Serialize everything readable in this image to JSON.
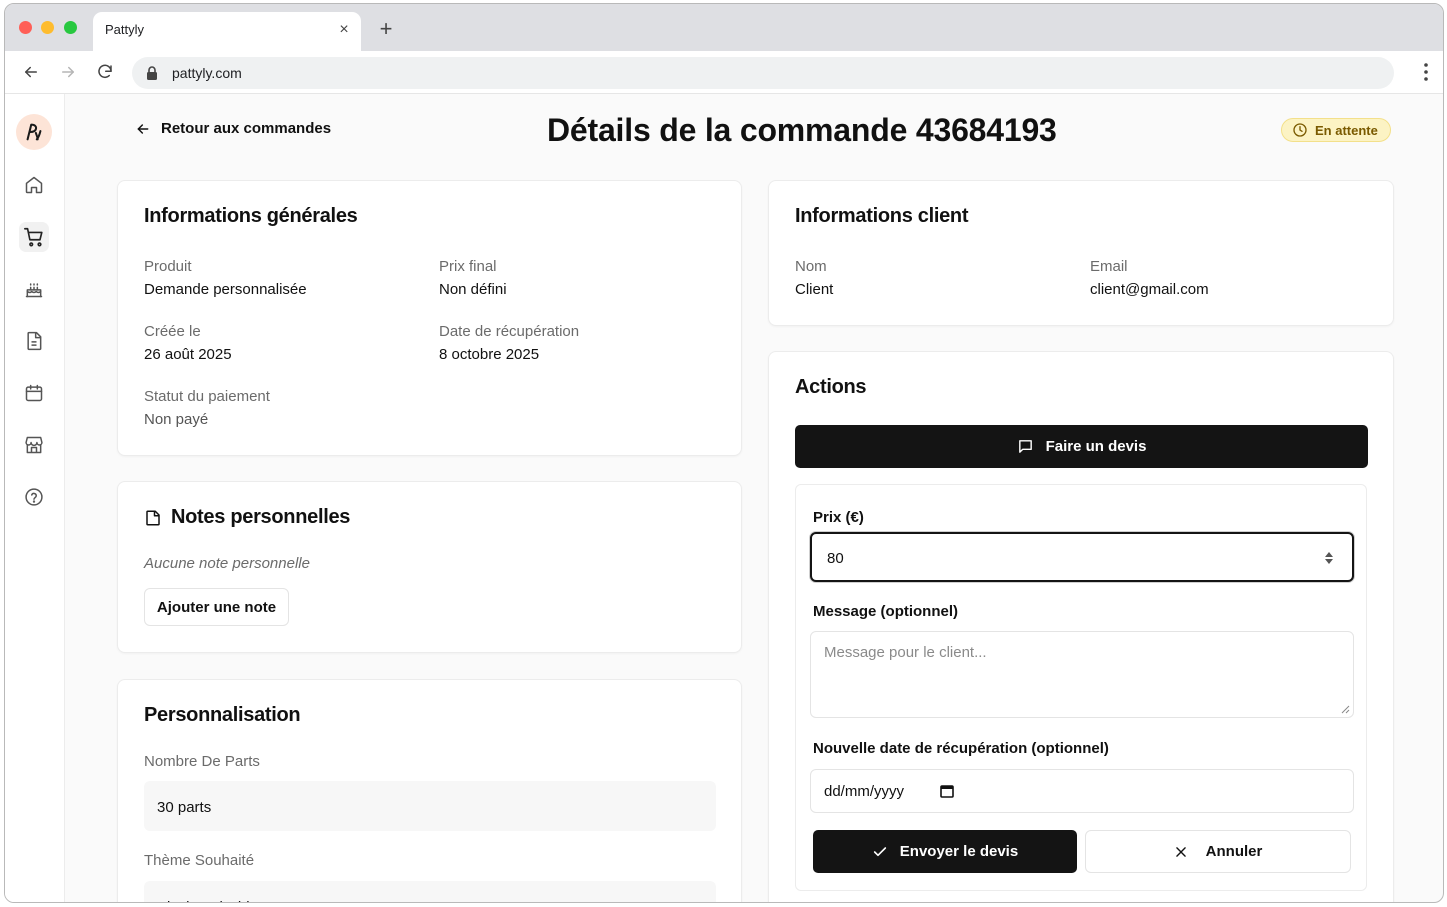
{
  "browser": {
    "tab_title": "Pattyly",
    "tab_close": "×",
    "new_tab": "+",
    "url": "pattyly.com"
  },
  "header": {
    "back_label": "Retour aux commandes",
    "title": "Détails de la commande 43684193",
    "status": "En attente"
  },
  "general": {
    "title": "Informations générales",
    "fields": [
      {
        "label": "Produit",
        "value": "Demande personnalisée"
      },
      {
        "label": "Prix final",
        "value": "Non défini"
      },
      {
        "label": "Créée le",
        "value": "26 août 2025"
      },
      {
        "label": "Date de récupération",
        "value": "8 octobre 2025"
      },
      {
        "label": "Statut du paiement",
        "value": "Non payé"
      }
    ]
  },
  "notes": {
    "title": "Notes personnelles",
    "empty": "Aucune note personnelle",
    "add_label": "Ajouter une note"
  },
  "customization": {
    "title": "Personnalisation",
    "items": [
      {
        "label": "Nombre De Parts",
        "value": "30 parts"
      },
      {
        "label": "Thème Souhaité",
        "value": "Black and white"
      }
    ]
  },
  "client": {
    "title": "Informations client",
    "name_label": "Nom",
    "name_value": "Client",
    "email_label": "Email",
    "email_value": "client@gmail.com"
  },
  "actions": {
    "title": "Actions",
    "quote_button": "Faire un devis",
    "price_label": "Prix (€)",
    "price_value": "80",
    "message_label": "Message (optionnel)",
    "message_placeholder": "Message pour le client...",
    "date_label": "Nouvelle date de récupération (optionnel)",
    "date_placeholder": "dd/mm/yyyy",
    "send_label": "Envoyer le devis",
    "cancel_label": "Annuler"
  },
  "colors": {
    "primary": "#141414",
    "status_bg": "#fcf3c4",
    "status_text": "#7a5a00",
    "logo_bg": "#fde4d7"
  }
}
